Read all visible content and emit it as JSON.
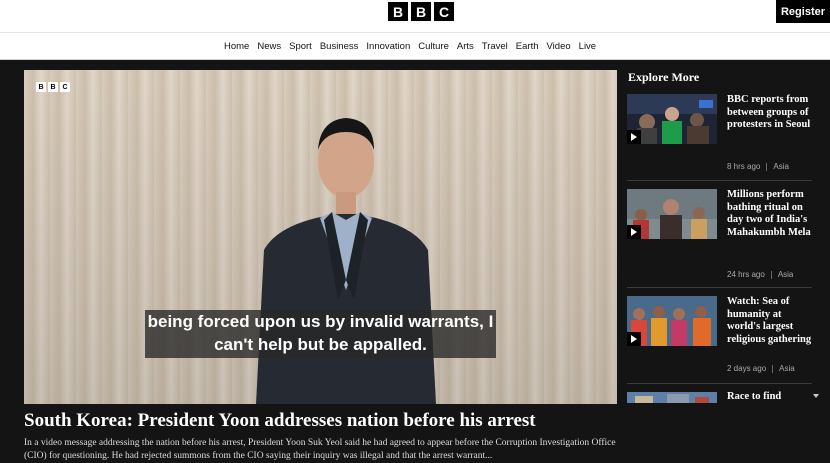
{
  "header": {
    "logo_letters": [
      "B",
      "B",
      "C"
    ],
    "register_label": "Register"
  },
  "nav": {
    "items": [
      "Home",
      "News",
      "Sport",
      "Business",
      "Innovation",
      "Culture",
      "Arts",
      "Travel",
      "Earth",
      "Video",
      "Live"
    ]
  },
  "video": {
    "watermark": [
      "B",
      "B",
      "C"
    ],
    "caption_line1": "being forced upon us by invalid warrants, I",
    "caption_line2": "can't help but be appalled."
  },
  "article": {
    "headline": "South Korea: President Yoon addresses nation before his arrest",
    "summary": "In a video message addressing the nation before his arrest, President Yoon Suk Yeol said he had agreed to appear before the Corruption Investigation Office (CIO) for questioning. He had rejected summons from the CIO saying their inquiry was illegal and that the arrest warrant..."
  },
  "sidebar": {
    "title": "Explore More",
    "cards": [
      {
        "title": "BBC reports from between groups of protesters in Seoul",
        "time": "8 hrs ago",
        "section": "Asia",
        "icon": "play-icon"
      },
      {
        "title": "Millions perform bathing ritual on day two of India's Mahakumbh Mela",
        "time": "24 hrs ago",
        "section": "Asia",
        "icon": "play-icon"
      },
      {
        "title": "Watch: Sea of humanity at world's largest religious gathering",
        "time": "2 days ago",
        "section": "Asia",
        "icon": "play-icon"
      },
      {
        "title": "Race to find",
        "time": "",
        "section": "",
        "icon": "play-icon"
      }
    ]
  },
  "colors": {
    "page_bg": "#141414",
    "header_bg": "#ffffff",
    "accent": "#000000"
  }
}
